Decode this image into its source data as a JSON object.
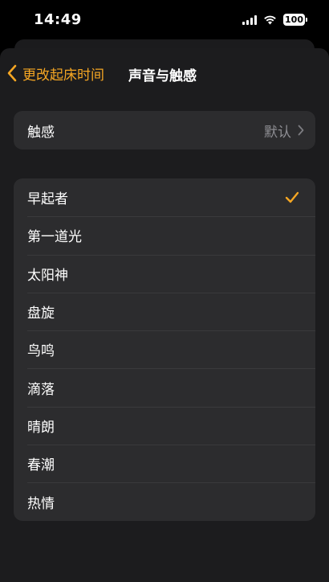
{
  "status": {
    "time": "14:49",
    "battery": "100",
    "icons": [
      "signal-icon",
      "wifi-icon",
      "battery-icon"
    ]
  },
  "nav": {
    "back_label": "更改起床时间",
    "title": "声音与触感"
  },
  "haptics": {
    "label": "触感",
    "value": "默认"
  },
  "sounds": {
    "items": [
      {
        "label": "早起者",
        "selected": true
      },
      {
        "label": "第一道光",
        "selected": false
      },
      {
        "label": "太阳神",
        "selected": false
      },
      {
        "label": "盘旋",
        "selected": false
      },
      {
        "label": "鸟鸣",
        "selected": false
      },
      {
        "label": "滴落",
        "selected": false
      },
      {
        "label": "晴朗",
        "selected": false
      },
      {
        "label": "春潮",
        "selected": false
      },
      {
        "label": "热情",
        "selected": false
      }
    ]
  },
  "colors": {
    "accent": "#f5a623",
    "background": "#000000",
    "sheet": "#1c1c1e",
    "cell": "#2c2c2e",
    "secondary_text": "#8e8e93"
  }
}
